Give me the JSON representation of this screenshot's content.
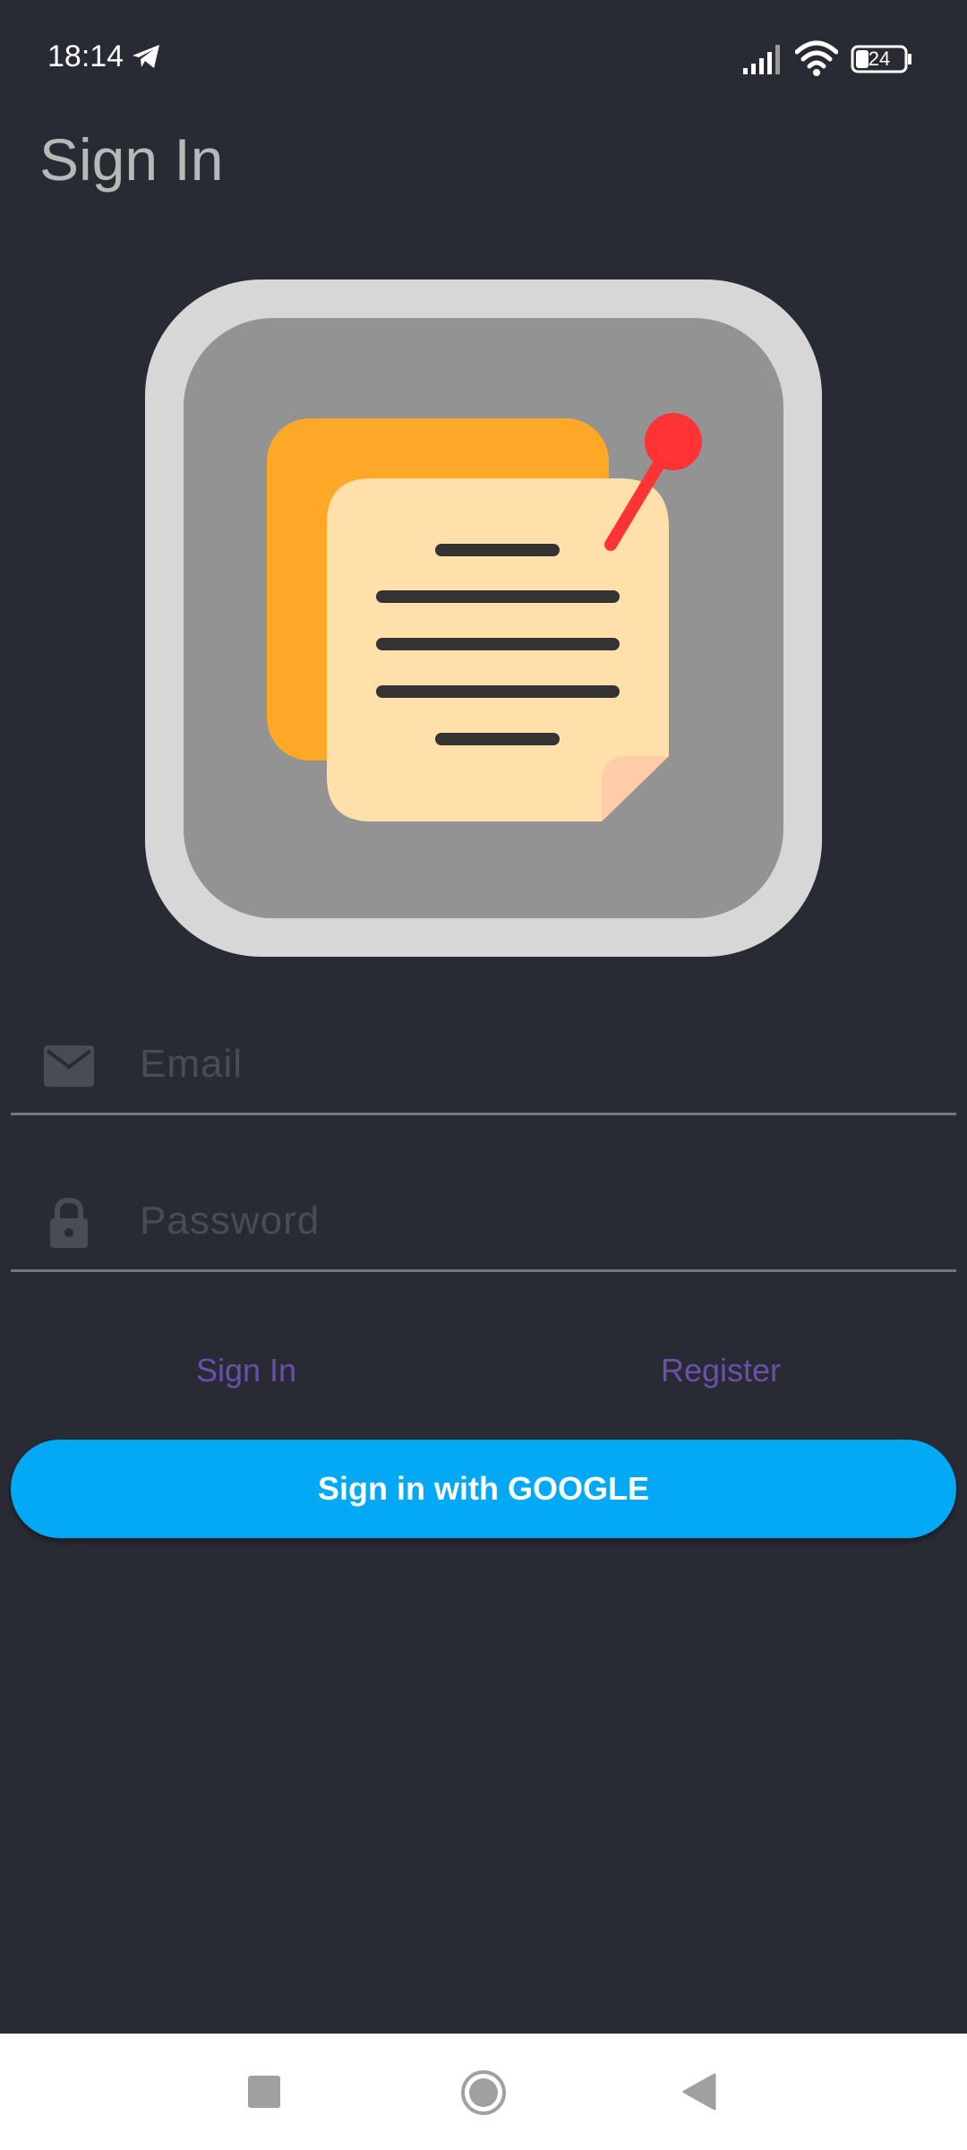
{
  "status_bar": {
    "time": "18:14",
    "battery_level": "24",
    "icons": [
      "telegram-icon",
      "signal-icon",
      "wifi-icon",
      "battery-icon"
    ]
  },
  "header": {
    "title": "Sign In"
  },
  "logo": {
    "icon": "sticky-notes-icon"
  },
  "form": {
    "email": {
      "placeholder": "Email",
      "value": "",
      "icon": "envelope-icon"
    },
    "password": {
      "placeholder": "Password",
      "value": "",
      "icon": "lock-icon"
    }
  },
  "actions": {
    "sign_in_label": "Sign In",
    "register_label": "Register",
    "google_label": "Sign in with GOOGLE"
  },
  "nav_bar": {
    "icons": [
      "recents-icon",
      "home-icon",
      "back-icon"
    ]
  },
  "colors": {
    "background": "#282b34",
    "accent_text_button": "#6b4fa8",
    "google_button": "#03a9f4",
    "title": "#b7b9b8"
  }
}
